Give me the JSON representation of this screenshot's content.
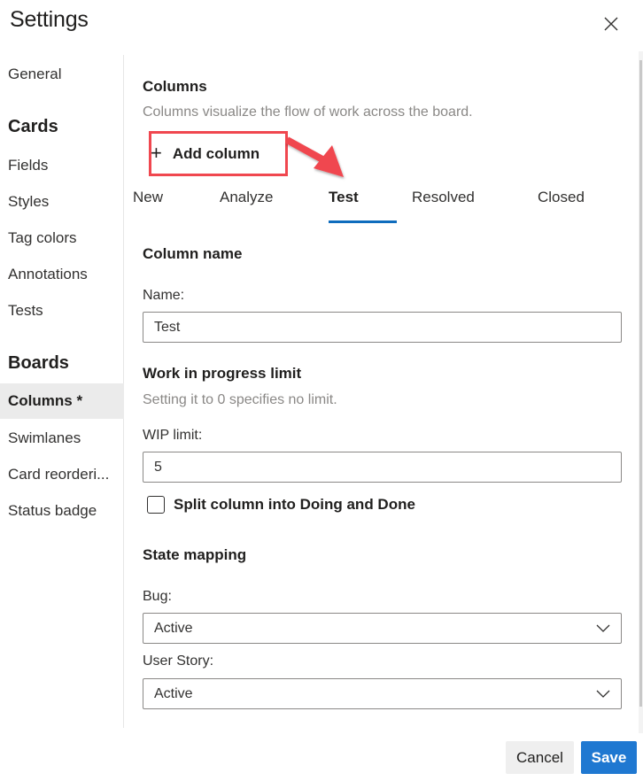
{
  "dialog": {
    "title": "Settings",
    "close_icon": "close-icon"
  },
  "sidebar": {
    "items": [
      {
        "label": "General",
        "type": "item"
      },
      {
        "label": "Cards",
        "type": "heading"
      },
      {
        "label": "Fields",
        "type": "item"
      },
      {
        "label": "Styles",
        "type": "item"
      },
      {
        "label": "Tag colors",
        "type": "item"
      },
      {
        "label": "Annotations",
        "type": "item"
      },
      {
        "label": "Tests",
        "type": "item"
      },
      {
        "label": "Boards",
        "type": "heading"
      },
      {
        "label": "Columns *",
        "type": "item",
        "selected": true
      },
      {
        "label": "Swimlanes",
        "type": "item"
      },
      {
        "label": "Card reorderi...",
        "type": "item"
      },
      {
        "label": "Status badge",
        "type": "item"
      }
    ]
  },
  "columns_section": {
    "title": "Columns",
    "description": "Columns visualize the flow of work across the board.",
    "add_column_icon": "plus-icon",
    "add_column_label": "Add column",
    "annotation": {
      "color": "#f0474f",
      "target": "add-column-button"
    }
  },
  "tabs": {
    "items": [
      {
        "label": "New"
      },
      {
        "label": "Analyze"
      },
      {
        "label": "Test",
        "active": true
      },
      {
        "label": "Resolved"
      },
      {
        "label": "Closed"
      }
    ],
    "accent_color": "#0f6cbd"
  },
  "column_name": {
    "title": "Column name",
    "name_label": "Name:",
    "name_value": "Test"
  },
  "wip": {
    "title": "Work in progress limit",
    "description": "Setting it to 0 specifies no limit.",
    "label": "WIP limit:",
    "value": "5",
    "split_label": "Split column into Doing and Done",
    "split_checked": false
  },
  "state_mapping": {
    "title": "State mapping",
    "bug_label": "Bug:",
    "bug_value": "Active",
    "user_story_label": "User Story:",
    "user_story_value": "Active",
    "chevron_icon": "chevron-down-icon"
  },
  "footer": {
    "cancel_label": "Cancel",
    "save_label": "Save",
    "primary_color": "#1f78d1"
  }
}
